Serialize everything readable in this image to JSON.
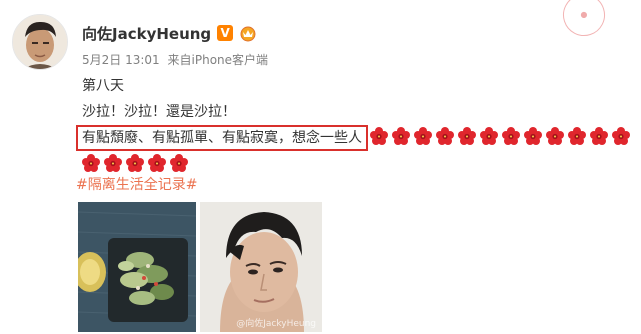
{
  "post": {
    "author_name": "向佐JackyHeung",
    "verified_badge": "V",
    "date": "5月2日 13:01",
    "source_prefix": "来自",
    "source_device": "iPhone客户端",
    "lines": {
      "day": "第八天",
      "salad": "沙拉！沙拉！還是沙拉！",
      "feelings": "有點頹廢、有點孤單、有點寂寞，想念一些人"
    },
    "hashtag": "#隔离生活全记录#",
    "photo_watermark": "@向佐JackyHeung"
  },
  "icons": {
    "flower": "red-hibiscus-emoji",
    "vip": "crown-badge-icon",
    "verified": "verified-v-badge-icon"
  },
  "colors": {
    "highlight_border": "#d9302c",
    "hashtag": "#eb7350",
    "verified": "#ff8200",
    "meta": "#808080"
  },
  "flowers_row1_count": 12,
  "flowers_row2_count": 5
}
